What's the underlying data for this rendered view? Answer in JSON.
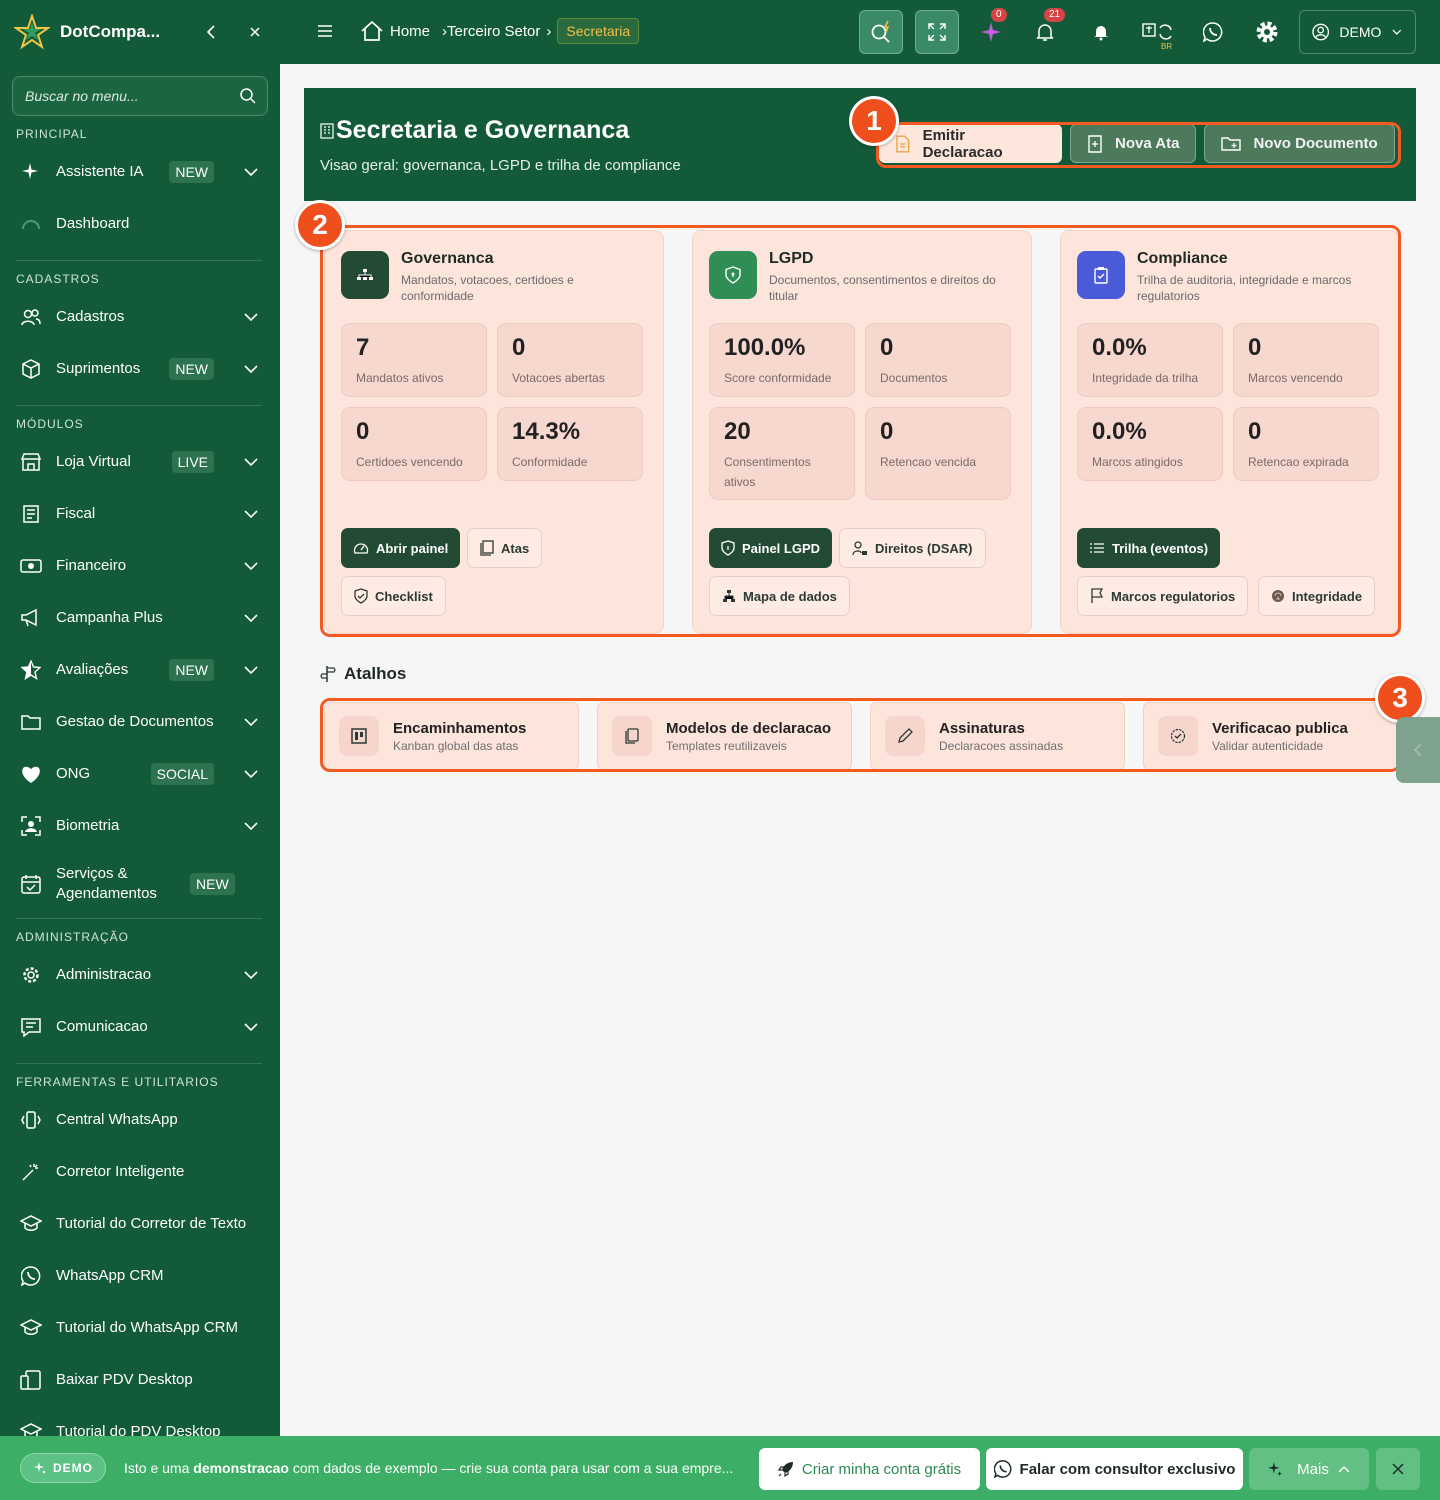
{
  "app": {
    "brand": "DotCompa..."
  },
  "sidebar": {
    "search_placeholder": "Buscar no menu...",
    "sections": {
      "principal": "PRINCIPAL",
      "cadastros": "CADASTROS",
      "modulos": "MÓDULOS",
      "administracao": "ADMINISTRAÇÃO",
      "ferramentas": "FERRAMENTAS E UTILITARIOS"
    },
    "items": {
      "assistente": {
        "label": "Assistente IA",
        "badge": "NEW"
      },
      "dashboard": {
        "label": "Dashboard"
      },
      "cadastros": {
        "label": "Cadastros"
      },
      "suprimentos": {
        "label": "Suprimentos",
        "badge": "NEW"
      },
      "loja": {
        "label": "Loja Virtual",
        "badge": "LIVE"
      },
      "fiscal": {
        "label": "Fiscal"
      },
      "financeiro": {
        "label": "Financeiro"
      },
      "campanha": {
        "label": "Campanha Plus"
      },
      "avaliacoes": {
        "label": "Avaliações",
        "badge": "NEW"
      },
      "gestao": {
        "label": "Gestao de Documentos"
      },
      "ong": {
        "label": "ONG",
        "badge": "SOCIAL"
      },
      "biometria": {
        "label": "Biometria"
      },
      "servicos": {
        "label": "Serviços & Agendamentos",
        "badge": "NEW"
      },
      "administracao": {
        "label": "Administracao"
      },
      "comunicacao": {
        "label": "Comunicacao"
      },
      "central_whatsapp": {
        "label": "Central WhatsApp"
      },
      "corretor": {
        "label": "Corretor Inteligente"
      },
      "tutorial_corretor": {
        "label": "Tutorial do Corretor de Texto"
      },
      "whatsapp_crm": {
        "label": "WhatsApp CRM"
      },
      "tutorial_whatsapp": {
        "label": "Tutorial do WhatsApp CRM"
      },
      "baixar_pdv": {
        "label": "Baixar PDV Desktop"
      },
      "tutorial_pdv": {
        "label": "Tutorial do PDV Desktop"
      }
    }
  },
  "topbar": {
    "breadcrumb": {
      "home": "Home",
      "terceiro": "Terceiro Setor",
      "current": "Secretaria"
    },
    "badges": {
      "sparkle": "0",
      "notifications": "21"
    },
    "lang": "BR",
    "user": "DEMO"
  },
  "hero": {
    "title": "Secretaria e Governanca",
    "subtitle": "Visao geral: governanca, LGPD e trilha de compliance",
    "actions": {
      "emitir": "Emitir Declaracao",
      "nova_ata": "Nova Ata",
      "novo_doc": "Novo Documento"
    }
  },
  "markers": {
    "one": "1",
    "two": "2",
    "three": "3"
  },
  "cards": {
    "governanca": {
      "title": "Governanca",
      "subtitle": "Mandatos, votacoes, certidoes e conformidade",
      "stats": [
        {
          "value": "7",
          "label": "Mandatos ativos"
        },
        {
          "value": "0",
          "label": "Votacoes abertas"
        },
        {
          "value": "0",
          "label": "Certidoes vencendo"
        },
        {
          "value": "14.3%",
          "label": "Conformidade"
        }
      ],
      "buttons": {
        "abrir": "Abrir painel",
        "atas": "Atas",
        "checklist": "Checklist"
      }
    },
    "lgpd": {
      "title": "LGPD",
      "subtitle": "Documentos, consentimentos e direitos do titular",
      "stats": [
        {
          "value": "100.0%",
          "label": "Score conformidade"
        },
        {
          "value": "0",
          "label": "Documentos"
        },
        {
          "value": "20",
          "label": "Consentimentos ativos"
        },
        {
          "value": "0",
          "label": "Retencao vencida"
        }
      ],
      "buttons": {
        "painel": "Painel LGPD",
        "direitos": "Direitos (DSAR)",
        "mapa": "Mapa de dados"
      }
    },
    "compliance": {
      "title": "Compliance",
      "subtitle": "Trilha de auditoria, integridade e marcos regulatorios",
      "stats": [
        {
          "value": "0.0%",
          "label": "Integridade da trilha"
        },
        {
          "value": "0",
          "label": "Marcos vencendo"
        },
        {
          "value": "0.0%",
          "label": "Marcos atingidos"
        },
        {
          "value": "0",
          "label": "Retencao expirada"
        }
      ],
      "buttons": {
        "trilha": "Trilha (eventos)",
        "marcos": "Marcos regulatorios",
        "integridade": "Integridade"
      }
    }
  },
  "atalhos": {
    "title": "Atalhos",
    "items": [
      {
        "title": "Encaminhamentos",
        "desc": "Kanban global das atas"
      },
      {
        "title": "Modelos de declaracao",
        "desc": "Templates reutilizaveis"
      },
      {
        "title": "Assinaturas",
        "desc": "Declaracoes assinadas"
      },
      {
        "title": "Verificacao publica",
        "desc": "Validar autenticidade"
      }
    ]
  },
  "bottom_bar": {
    "pill": "DEMO",
    "msg_pre": "Isto e uma ",
    "msg_bold": "demonstracao",
    "msg_post": " com dados de exemplo — crie sua conta para usar com a sua empre...",
    "criar": "Criar minha conta grátis",
    "falar": "Falar com consultor exclusivo",
    "mais": "Mais"
  },
  "colors": {
    "brand": "#135b38",
    "highlight": "#f25a22",
    "card_bg": "#fde5dc",
    "accent_gold": "#f2c14a"
  }
}
